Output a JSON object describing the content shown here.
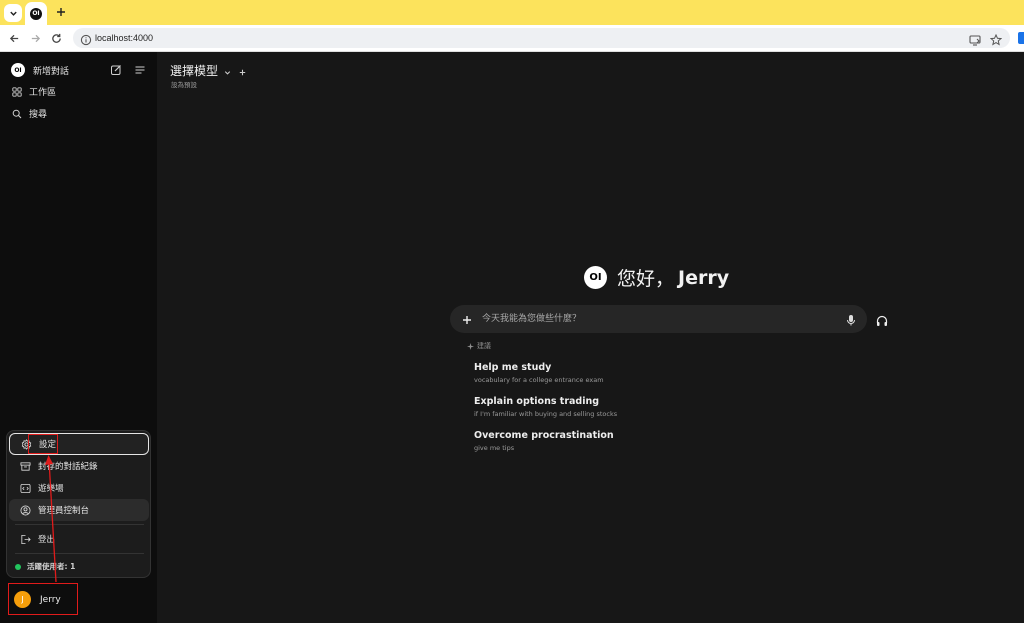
{
  "browser": {
    "tab_logo": "OI",
    "url": "localhost:4000"
  },
  "sidebar": {
    "logo": "OI",
    "new_chat": "新增對話",
    "workspace": "工作區",
    "search": "搜尋"
  },
  "menu": {
    "settings": "設定",
    "archived": "封存的對話紀錄",
    "playground": "遊樂場",
    "admin": "管理員控制台",
    "logout": "登出",
    "active_users": "活躍使用者: 1"
  },
  "user": {
    "initial": "J",
    "name": "Jerry"
  },
  "main": {
    "model_select": "選擇模型",
    "set_default": "設為預設",
    "greeting_logo": "OI",
    "greeting": "您好，",
    "greeting_name": "Jerry",
    "prompt_placeholder": "今天我能為您做些什麼？",
    "suggested_label": "建議",
    "suggestions": [
      {
        "title": "Help me study",
        "subtitle": "vocabulary for a college entrance exam"
      },
      {
        "title": "Explain options trading",
        "subtitle": "if I'm familiar with buying and selling stocks"
      },
      {
        "title": "Overcome procrastination",
        "subtitle": "give me tips"
      }
    ]
  },
  "colors": {
    "tabbar": "#fce35c",
    "sidebar_bg": "#0d0d0d",
    "main_bg": "#171717",
    "avatar": "#f59e0b",
    "active_dot": "#22c55e",
    "annotation": "#e01b1b"
  }
}
